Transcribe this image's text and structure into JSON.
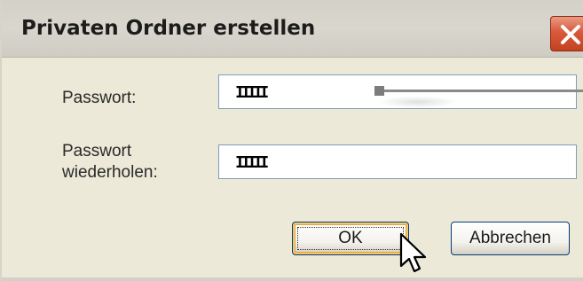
{
  "dialog": {
    "title": "Privaten Ordner erstellen",
    "close_glyph": "✕"
  },
  "form": {
    "password_label": "Passwort:",
    "password_value": "IIIII",
    "repeat_label_line1": "Passwort",
    "repeat_label_line2": "wiederholen:",
    "repeat_value": "IIIII"
  },
  "buttons": {
    "ok_label": "OK",
    "cancel_label": "Abbrechen"
  },
  "icons": {
    "close": "close-icon",
    "cursor": "mouse-pointer-icon"
  },
  "colors": {
    "dialog_bg": "#ece9d8",
    "close_red": "#d8593c",
    "field_border": "#7f9db9"
  }
}
